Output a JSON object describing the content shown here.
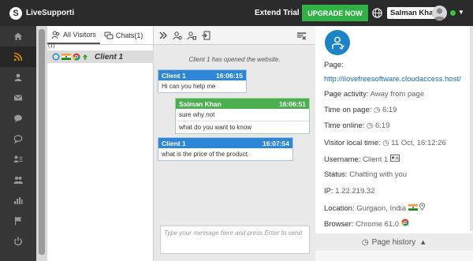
{
  "app": {
    "name": "LiveSupporti",
    "logo_letter": "S"
  },
  "topbar": {
    "extend_label": "Extend Trial",
    "upgrade_label": "UPGRADE NOW",
    "user_name": "Salman Khan",
    "status_color": "#3cc23c",
    "upgrade_color": "#2fb146"
  },
  "sidebar": {
    "items": [
      {
        "icon": "home-icon"
      },
      {
        "icon": "rss-icon",
        "active": true
      },
      {
        "icon": "users-icon"
      },
      {
        "icon": "mail-icon"
      },
      {
        "icon": "chat-icon"
      },
      {
        "icon": "comment-icon"
      },
      {
        "icon": "user-list-icon"
      },
      {
        "icon": "group-icon"
      },
      {
        "icon": "bar-chart-icon"
      },
      {
        "icon": "flag-icon"
      },
      {
        "icon": "power-icon"
      }
    ]
  },
  "visitors": {
    "tab_all": "All Visitors",
    "tab_chats": "Chats(1)",
    "count": "(1)",
    "list": [
      {
        "name": "Client 1"
      }
    ]
  },
  "chat": {
    "system_message": "Client 1 has opened the website.",
    "messages": [
      {
        "sender": "Client 1",
        "time": "16:06:15",
        "lines": [
          "Hi can you help me"
        ],
        "role": "visitor"
      },
      {
        "sender": "Salman Khan",
        "time": "16:06:51",
        "lines": [
          "sure why not",
          "what do you want to know"
        ],
        "role": "agent"
      },
      {
        "sender": "Client 1",
        "time": "16:07:54",
        "lines": [
          "what is the price of the product"
        ],
        "role": "visitor"
      }
    ],
    "input_placeholder": "Type your message here and press Enter to send"
  },
  "info": {
    "page_label": "Page:",
    "page_url": "http://ilovefreesoftware.cloudaccess.host/",
    "activity_label": "Page activity:",
    "activity_value": "Away from page",
    "time_on_page_label": "Time on page:",
    "time_on_page_value": "6:19",
    "time_online_label": "Time online:",
    "time_online_value": "6:19",
    "local_time_label": "Visitor local time:",
    "local_time_value": "11 Oct, 16:12:26",
    "username_label": "Username:",
    "username_value": "Client 1",
    "status_label": "Status:",
    "status_value": "Chatting with you",
    "ip_label": "IP:",
    "ip_value": "1.22.219.32",
    "location_label": "Location:",
    "location_value": "Gurgaon, India",
    "browser_label": "Browser:",
    "browser_value": "Chrome 61.0",
    "page_history_label": "Page history"
  }
}
